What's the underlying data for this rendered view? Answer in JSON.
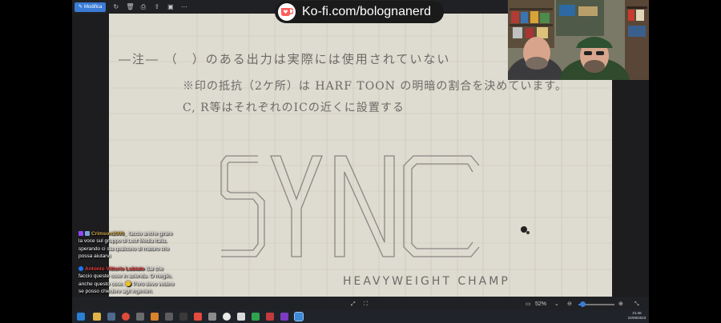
{
  "toolbar": {
    "edit_label": "Modifica",
    "icons": [
      "rotate-icon",
      "delete-icon",
      "print-icon",
      "share-icon",
      "slideshow-icon",
      "more-icon"
    ]
  },
  "kofi": {
    "text": "Ko-fi.com/bolognanerd"
  },
  "document": {
    "note1": "―注― （　）のある出力は実際には使用されていない",
    "note2": "※印の抵抗（2ケ所）は HARF TOON の明暗の割合を決めています。",
    "note3": "C, R等はそれぞれのICの近くに設置する",
    "big_title": "SYNC",
    "sub_label": "HEAVYWEIGHT CHAMP"
  },
  "bottombar": {
    "zoom_value": "52%",
    "zoom_level": 0.12
  },
  "chat": {
    "messages": [
      {
        "platform": "twitch",
        "user": "Crimson2000_",
        "text": " facciο anche girare la voce sul gruppo di Lost Media Italia, sperando ci sia qualcuno di maturo che possa aiutarvi"
      },
      {
        "platform": "facebook",
        "user": "Antonio Vittorio Lubiato",
        "text": " Sai che faccio queste cose in azienda. O meglio, anche questo cose. 🙂 Però devo vedere se posso chiedere agli ingenieri."
      }
    ]
  },
  "taskbar": {
    "time": "21:46",
    "date": "22/09/2023"
  },
  "colors": {
    "accent": "#3a7bd5",
    "paper": "#dedbd0",
    "pencil": "#6d6a68",
    "twitch": "#9146ff",
    "facebook": "#1877f2",
    "kofi": "#ff5e5b"
  }
}
